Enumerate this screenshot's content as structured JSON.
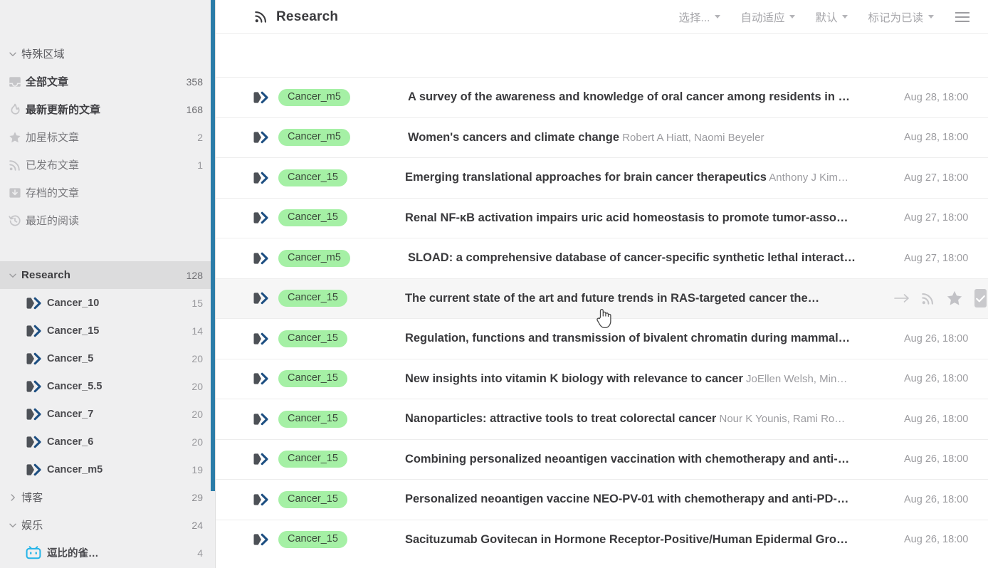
{
  "sidebar": {
    "special_group": {
      "label": "特殊区域",
      "caret": "chevron-down-icon"
    },
    "special_items": [
      {
        "icon": "inbox-icon",
        "label": "全部文章",
        "count": "358",
        "bold": true
      },
      {
        "icon": "flame-icon",
        "label": "最新更新的文章",
        "count": "168",
        "bold": true
      },
      {
        "icon": "star-icon",
        "label": "加星标文章",
        "count": "2",
        "bold": false
      },
      {
        "icon": "rss-icon",
        "label": "已发布文章",
        "count": "1",
        "bold": false
      },
      {
        "icon": "archive-icon",
        "label": "存档的文章",
        "count": "",
        "bold": false
      },
      {
        "icon": "history-icon",
        "label": "最近的阅读",
        "count": "",
        "bold": false
      }
    ],
    "research_group": {
      "label": "Research",
      "count": "128",
      "caret": "chevron-down-icon",
      "active": true
    },
    "research_feeds": [
      {
        "icon": "feed-icon",
        "label": "Cancer_10",
        "count": "15"
      },
      {
        "icon": "feed-icon",
        "label": "Cancer_15",
        "count": "14"
      },
      {
        "icon": "feed-icon",
        "label": "Cancer_5",
        "count": "20"
      },
      {
        "icon": "feed-icon",
        "label": "Cancer_5.5",
        "count": "20"
      },
      {
        "icon": "feed-icon",
        "label": "Cancer_7",
        "count": "20"
      },
      {
        "icon": "feed-icon",
        "label": "Cancer_6",
        "count": "20"
      },
      {
        "icon": "feed-icon",
        "label": "Cancer_m5",
        "count": "19"
      }
    ],
    "blog_group": {
      "label": "博客",
      "count": "29",
      "caret": "chevron-right-icon"
    },
    "entertainment_group": {
      "label": "娱乐",
      "count": "24",
      "caret": "chevron-down-icon"
    },
    "entertainment_items": [
      {
        "icon": "bilibili-icon",
        "label": "逗比的雀…",
        "count": "4"
      }
    ],
    "scrollbar_color": "#2b7ca8"
  },
  "topbar": {
    "rss_icon": "rss-icon",
    "title": "Research",
    "menus": [
      {
        "label": "选择...",
        "caret": "chevron-down-icon"
      },
      {
        "label": "自动适应",
        "caret": "chevron-down-icon"
      },
      {
        "label": "默认",
        "caret": "chevron-down-icon"
      },
      {
        "label": "标记为已读",
        "caret": "chevron-down-icon"
      }
    ],
    "hamburger_icon": "hamburger-icon"
  },
  "list": {
    "row_actions": [
      {
        "icon": "arrow-right-icon",
        "name": "open-article"
      },
      {
        "icon": "rss-icon",
        "name": "open-feed"
      },
      {
        "icon": "star-icon",
        "name": "star-article"
      },
      {
        "icon": "check-icon",
        "name": "mark-read"
      }
    ],
    "rows": [
      {
        "icon": "feed-icon",
        "tag": "Cancer_m5",
        "title": "A survey of the awareness and knowledge of oral cancer among residents in …",
        "authors": "",
        "date": "Aug 28, 18:00",
        "hover": false
      },
      {
        "icon": "feed-icon",
        "tag": "Cancer_m5",
        "title": "Women's cancers and climate change",
        "authors": "Robert A Hiatt, Naomi Beyeler",
        "date": "Aug 28, 18:00",
        "hover": false
      },
      {
        "icon": "feed-icon",
        "tag": "Cancer_15",
        "title": "Emerging translational approaches for brain cancer therapeutics",
        "authors": "Anthony J Kim…",
        "date": "Aug 27, 18:00",
        "hover": false
      },
      {
        "icon": "feed-icon",
        "tag": "Cancer_15",
        "title": "Renal NF-κB activation impairs uric acid homeostasis to promote tumor-asso…",
        "authors": "",
        "date": "Aug 27, 18:00",
        "hover": false
      },
      {
        "icon": "feed-icon",
        "tag": "Cancer_m5",
        "title": "SLOAD: a comprehensive database of cancer-specific synthetic lethal interact…",
        "authors": "",
        "date": "Aug 27, 18:00",
        "hover": false
      },
      {
        "icon": "feed-icon",
        "tag": "Cancer_15",
        "title": "The current state of the art and future trends in RAS-targeted cancer the…",
        "authors": "",
        "date": "",
        "hover": true
      },
      {
        "icon": "feed-icon",
        "tag": "Cancer_15",
        "title": "Regulation, functions and transmission of bivalent chromatin during mammal…",
        "authors": "",
        "date": "Aug 26, 18:00",
        "hover": false
      },
      {
        "icon": "feed-icon",
        "tag": "Cancer_15",
        "title": "New insights into vitamin K biology with relevance to cancer",
        "authors": "JoEllen Welsh, Min…",
        "date": "Aug 26, 18:00",
        "hover": false
      },
      {
        "icon": "feed-icon",
        "tag": "Cancer_15",
        "title": "Nanoparticles: attractive tools to treat colorectal cancer",
        "authors": "Nour K Younis, Rami Ro…",
        "date": "Aug 26, 18:00",
        "hover": false
      },
      {
        "icon": "feed-icon",
        "tag": "Cancer_15",
        "title": "Combining personalized neoantigen vaccination with chemotherapy and anti-…",
        "authors": "",
        "date": "Aug 26, 18:00",
        "hover": false
      },
      {
        "icon": "feed-icon",
        "tag": "Cancer_15",
        "title": "Personalized neoantigen vaccine NEO-PV-01 with chemotherapy and anti-PD-…",
        "authors": "",
        "date": "Aug 26, 18:00",
        "hover": false
      },
      {
        "icon": "feed-icon",
        "tag": "Cancer_15",
        "title": "Sacituzumab Govitecan in Hormone Receptor-Positive/Human Epidermal Gro…",
        "authors": "",
        "date": "Aug 26, 18:00",
        "hover": false
      }
    ],
    "tag_color": "#a5f0a5",
    "hover_color": "#f6f6f6"
  }
}
